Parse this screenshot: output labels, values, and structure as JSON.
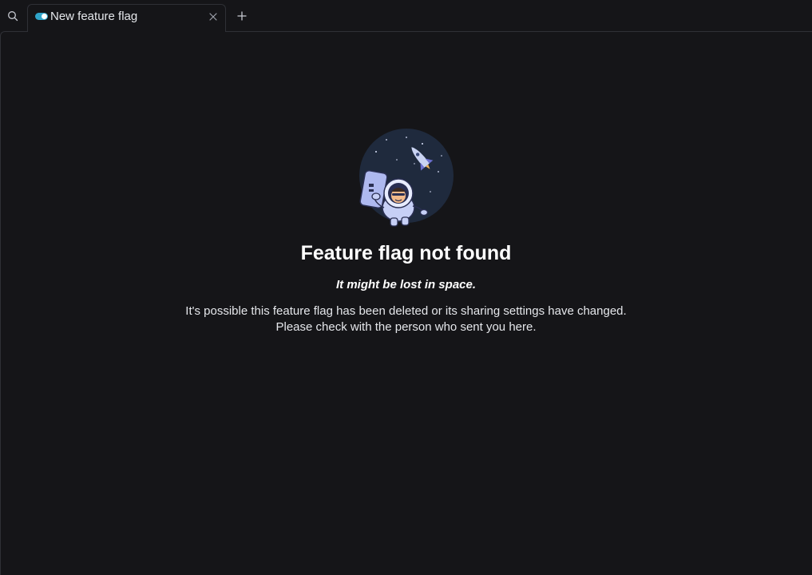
{
  "tabs": [
    {
      "title": "New feature flag",
      "icon": "feature-flag-toggle-icon",
      "active": true
    }
  ],
  "toolbar": {
    "search_icon": "search-icon",
    "new_tab_icon": "plus-icon",
    "close_icon": "close-icon"
  },
  "not_found": {
    "title": "Feature flag not found",
    "subtitle": "It might be lost in space.",
    "body_line1": "It's possible this feature flag has been deleted or its sharing settings have changed.",
    "body_line2": "Please check with the person who sent you here.",
    "illustration": "astronaut-in-space-illustration"
  },
  "colors": {
    "background": "#151518",
    "border": "#2f3036",
    "flag_icon_accent": "#2fa4c9",
    "text_primary": "#ffffff",
    "text_secondary": "#e5e7eb"
  }
}
